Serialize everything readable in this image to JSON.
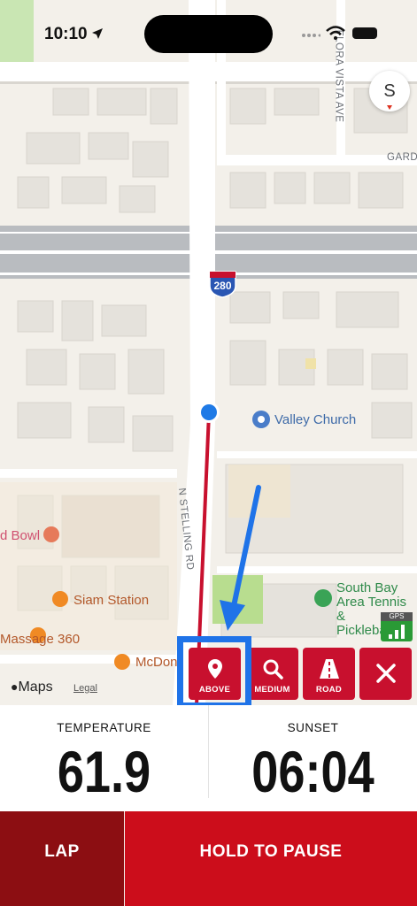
{
  "status_bar": {
    "time": "10:10"
  },
  "map": {
    "compass_label": "S",
    "highway_shield": "280",
    "poi": {
      "valley_church": "Valley Church",
      "bowl": "d Bowl",
      "siam_station": "Siam Station",
      "massage": "Massage 360",
      "mcdonalds": "McDon",
      "south_bay": [
        "South Bay",
        "Area Tennis &",
        "Pickleball"
      ]
    },
    "roads": {
      "n_stelling": "N STELLING RD",
      "flora_vista": "FLORA VISTA AVE",
      "gard": "GARD"
    },
    "maps_logo": "Maps",
    "legal": "Legal",
    "gps_label": "GPS"
  },
  "map_controls": {
    "above": "ABOVE",
    "medium": "MEDIUM",
    "road": "ROAD"
  },
  "stats": {
    "temperature_label": "TEMPERATURE",
    "temperature_value": "61.9",
    "sunset_label": "SUNSET",
    "sunset_value": "06:04"
  },
  "actions": {
    "lap": "LAP",
    "hold_to_pause": "HOLD TO PAUSE"
  },
  "colors": {
    "accent_red": "#c8102e",
    "dark_red": "#8c0e12",
    "highlight_blue": "#1f73e8"
  }
}
